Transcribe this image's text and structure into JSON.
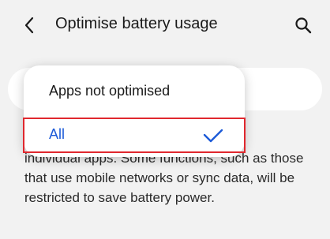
{
  "header": {
    "title": "Optimise battery usage",
    "back_icon": "chevron-left-icon",
    "search_icon": "search-icon"
  },
  "filter_menu": {
    "items": [
      {
        "label": "Apps not optimised",
        "selected": false
      },
      {
        "label": "All",
        "selected": true,
        "indicator_icon": "checkmark-icon"
      }
    ],
    "selected_color": "#1c5ad8"
  },
  "description": "individual apps. Some functions, such as those that use mobile networks or sync data, will be restricted to save battery power.",
  "highlight_color": "#e0282e"
}
